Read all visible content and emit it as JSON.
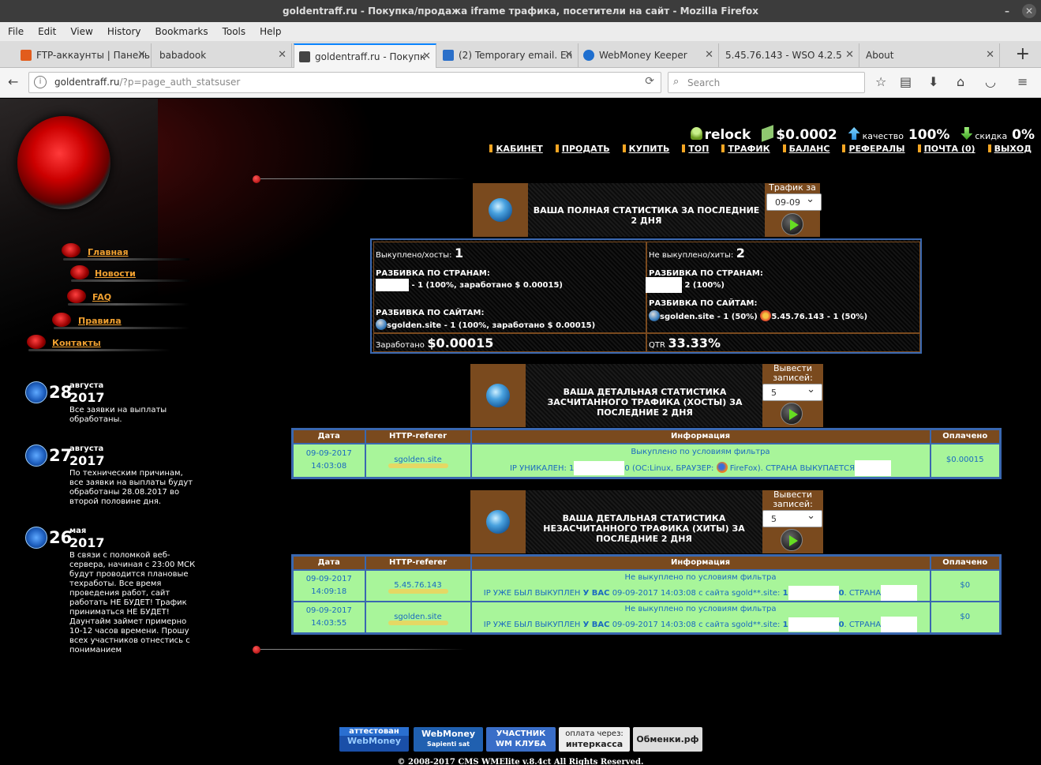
{
  "window": {
    "title": "goldentraff.ru - Покупка/продажа iframe трафика, посетители на сайт - Mozilla Firefox"
  },
  "menu": [
    "File",
    "Edit",
    "View",
    "History",
    "Bookmarks",
    "Tools",
    "Help"
  ],
  "tabs": [
    {
      "label": "FTP-аккаунты | Панель",
      "color": "#e25c1c"
    },
    {
      "label": "babadook",
      "color": ""
    },
    {
      "label": "goldentraff.ru - Покупк",
      "color": "#444"
    },
    {
      "label": "(2) Temporary email. En",
      "color": "#2a6fc9"
    },
    {
      "label": "WebMoney Keeper",
      "color": "#1f6fcf"
    },
    {
      "label": "5.45.76.143 - WSO 4.2.5",
      "color": ""
    },
    {
      "label": "About",
      "color": ""
    }
  ],
  "url": {
    "host": "goldentraff.ru",
    "path": "/?p=page_auth_statsuser"
  },
  "search": {
    "placeholder": "Search"
  },
  "user": {
    "name": "relock",
    "balance": "$0.0002",
    "quality_label": "качество",
    "quality": "100%",
    "discount_label": "скидка",
    "discount": "0%"
  },
  "topnav": [
    "КАБИНЕТ",
    "ПРОДАТЬ",
    "КУПИТЬ",
    "ТОП",
    "ТРАФИК",
    "БАЛАНС",
    "РЕФЕРАЛЫ",
    "ПОЧТА (0)",
    "ВЫХОД"
  ],
  "sidemenu": [
    "Главная",
    "Новости",
    "FAQ",
    "Правила",
    "Контакты"
  ],
  "news": [
    {
      "day": "28",
      "month": "августа",
      "year": "2017",
      "text": "Все заявки на выплаты обработаны."
    },
    {
      "day": "27",
      "month": "августа",
      "year": "2017",
      "text": "По техническим причинам, все заявки на выплаты будут обработаны 28.08.2017 во второй половине дня."
    },
    {
      "day": "26",
      "month": "мая",
      "year": "2017",
      "text": "В связи с поломкой веб-сервера, начиная с 23:00 МСК будут проводится плановые техработы. Все время проведения работ, сайт работать НЕ БУДЕТ! Трафик приниматься НЕ БУДЕТ! Даунтайм займет примерно 10-12 часов времени. Прошу всех участников отнестись с пониманием"
    }
  ],
  "stats_full": {
    "title": "ВАША ПОЛНАЯ СТАТИСТИКА ЗА ПОСЛЕДНИЕ 2 ДНЯ",
    "filter_label": "Трафик за",
    "filter_value": "09-09",
    "bought_label": "Выкуплено/хосты:",
    "bought_value": "1",
    "not_bought_label": "Не выкуплено/хиты:",
    "not_bought_value": "2",
    "by_country": "РАЗБИВКА ПО СТРАНАМ:",
    "by_site": "РАЗБИВКА ПО САЙТАМ:",
    "left_country_line": " - 1 (100%, заработано $ 0.00015)",
    "right_country_line": " 2 (100%)",
    "left_site_line": "sgolden.site - 1 (100%, заработано $ 0.00015)",
    "right_site_line_1": "sgolden.site - 1 (50%)",
    "right_site_line_2": "5.45.76.143 - 1 (50%)",
    "earned_label": "Заработано",
    "earned_value": "$0.00015",
    "qtr_label": "QTR",
    "qtr_value": "33.33%"
  },
  "stats_counted": {
    "title": "ВАША ДЕТАЛЬНАЯ СТАТИСТИКА ЗАСЧИТАННОГО ТРАФИКА (ХОСТЫ) ЗА ПОСЛЕДНИЕ 2 ДНЯ",
    "limit_label": "Вывести записей:",
    "limit_value": "5",
    "columns": [
      "Дата",
      "HTTP-referer",
      "Информация",
      "Оплачено"
    ],
    "rows": [
      {
        "date": "09-09-2017",
        "time": "14:03:08",
        "referer": "sgolden.site",
        "info1": "Выкуплено по условиям фильтра",
        "info2a": "IP УНИКАЛЕН: 1",
        "info2b": "0 (OC:Linux, БРАУЗЕР: ",
        "info2c": "FireFox). СТРАНА ВЫКУПАЕТСЯ",
        "paid": "$0.00015"
      }
    ]
  },
  "stats_uncounted": {
    "title": "ВАША ДЕТАЛЬНАЯ СТАТИСТИКА НЕЗАСЧИТАННОГО ТРАФИКА (ХИТЫ) ЗА ПОСЛЕДНИЕ 2 ДНЯ",
    "limit_label": "Вывести записей:",
    "limit_value": "5",
    "columns": [
      "Дата",
      "HTTP-referer",
      "Информация",
      "Оплачено"
    ],
    "rows": [
      {
        "date": "09-09-2017",
        "time": "14:09:18",
        "referer": "5.45.76.143",
        "info1": "Не выкуплено по условиям фильтра",
        "info2a": "IP УЖЕ БЫЛ ВЫКУПЛЕН ",
        "info2b": "У ВАС",
        "info2c": " 09-09-2017 14:03:08 с сайта sgold**.site: ",
        "info2d": "1",
        "info2e": "0",
        "info2f": ". СТРАНА",
        "paid": "$0"
      },
      {
        "date": "09-09-2017",
        "time": "14:03:55",
        "referer": "sgolden.site",
        "info1": "Не выкуплено по условиям фильтра",
        "info2a": "IP УЖЕ БЫЛ ВЫКУПЛЕН ",
        "info2b": "У ВАС",
        "info2c": " 09-09-2017 14:03:08 с сайта sgold**.site: ",
        "info2d": "1",
        "info2e": "0",
        "info2f": ". СТРАНА",
        "paid": "$0"
      }
    ]
  },
  "footer": {
    "badges": [
      {
        "top": "аттестован",
        "bottom": "WebMoney"
      },
      {
        "top": "WebMoney",
        "bottom": "Sapienti sat"
      },
      {
        "top": "УЧАСТНИК",
        "bottom": "WM КЛУБА"
      },
      {
        "top": "оплата через:",
        "bottom": "интеркасса"
      },
      {
        "top": "Обменки.рф",
        "bottom": ""
      }
    ],
    "copyright": "© 2008-2017 CMS WMElite v.8.4ct All Rights Reserved."
  }
}
